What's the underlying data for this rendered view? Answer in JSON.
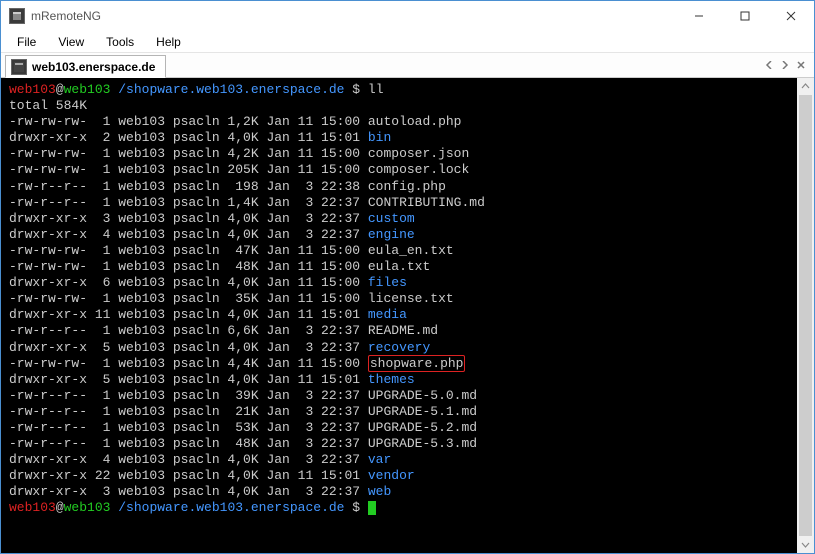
{
  "titlebar": {
    "title": "mRemoteNG"
  },
  "menu": {
    "file": "File",
    "view": "View",
    "tools": "Tools",
    "help": "Help"
  },
  "tab": {
    "label": "web103.enerspace.de"
  },
  "prompt": {
    "user": "web103",
    "at": "@",
    "host": "web103",
    "path": " /shopware.web103.enerspace.de",
    "sep": " $ ",
    "cmd": "ll"
  },
  "total": "total 584K",
  "files": [
    {
      "perm": "-rw-rw-rw-",
      "links": " 1",
      "own": "web103",
      "grp": "psacln",
      "size": "1,2K",
      "date": "Jan 11 15:00",
      "name": "autoload.php",
      "color": "white"
    },
    {
      "perm": "drwxr-xr-x",
      "links": " 2",
      "own": "web103",
      "grp": "psacln",
      "size": "4,0K",
      "date": "Jan 11 15:01",
      "name": "bin",
      "color": "blue"
    },
    {
      "perm": "-rw-rw-rw-",
      "links": " 1",
      "own": "web103",
      "grp": "psacln",
      "size": "4,2K",
      "date": "Jan 11 15:00",
      "name": "composer.json",
      "color": "white"
    },
    {
      "perm": "-rw-rw-rw-",
      "links": " 1",
      "own": "web103",
      "grp": "psacln",
      "size": "205K",
      "date": "Jan 11 15:00",
      "name": "composer.lock",
      "color": "white"
    },
    {
      "perm": "-rw-r--r--",
      "links": " 1",
      "own": "web103",
      "grp": "psacln",
      "size": " 198",
      "date": "Jan  3 22:38",
      "name": "config.php",
      "color": "white"
    },
    {
      "perm": "-rw-r--r--",
      "links": " 1",
      "own": "web103",
      "grp": "psacln",
      "size": "1,4K",
      "date": "Jan  3 22:37",
      "name": "CONTRIBUTING.md",
      "color": "white"
    },
    {
      "perm": "drwxr-xr-x",
      "links": " 3",
      "own": "web103",
      "grp": "psacln",
      "size": "4,0K",
      "date": "Jan  3 22:37",
      "name": "custom",
      "color": "blue"
    },
    {
      "perm": "drwxr-xr-x",
      "links": " 4",
      "own": "web103",
      "grp": "psacln",
      "size": "4,0K",
      "date": "Jan  3 22:37",
      "name": "engine",
      "color": "blue"
    },
    {
      "perm": "-rw-rw-rw-",
      "links": " 1",
      "own": "web103",
      "grp": "psacln",
      "size": " 47K",
      "date": "Jan 11 15:00",
      "name": "eula_en.txt",
      "color": "white"
    },
    {
      "perm": "-rw-rw-rw-",
      "links": " 1",
      "own": "web103",
      "grp": "psacln",
      "size": " 48K",
      "date": "Jan 11 15:00",
      "name": "eula.txt",
      "color": "white"
    },
    {
      "perm": "drwxr-xr-x",
      "links": " 6",
      "own": "web103",
      "grp": "psacln",
      "size": "4,0K",
      "date": "Jan 11 15:00",
      "name": "files",
      "color": "blue"
    },
    {
      "perm": "-rw-rw-rw-",
      "links": " 1",
      "own": "web103",
      "grp": "psacln",
      "size": " 35K",
      "date": "Jan 11 15:00",
      "name": "license.txt",
      "color": "white"
    },
    {
      "perm": "drwxr-xr-x",
      "links": "11",
      "own": "web103",
      "grp": "psacln",
      "size": "4,0K",
      "date": "Jan 11 15:01",
      "name": "media",
      "color": "blue"
    },
    {
      "perm": "-rw-r--r--",
      "links": " 1",
      "own": "web103",
      "grp": "psacln",
      "size": "6,6K",
      "date": "Jan  3 22:37",
      "name": "README.md",
      "color": "white"
    },
    {
      "perm": "drwxr-xr-x",
      "links": " 5",
      "own": "web103",
      "grp": "psacln",
      "size": "4,0K",
      "date": "Jan  3 22:37",
      "name": "recovery",
      "color": "blue"
    },
    {
      "perm": "-rw-rw-rw-",
      "links": " 1",
      "own": "web103",
      "grp": "psacln",
      "size": "4,4K",
      "date": "Jan 11 15:00",
      "name": "shopware.php",
      "color": "white",
      "hl": true
    },
    {
      "perm": "drwxr-xr-x",
      "links": " 5",
      "own": "web103",
      "grp": "psacln",
      "size": "4,0K",
      "date": "Jan 11 15:01",
      "name": "themes",
      "color": "blue"
    },
    {
      "perm": "-rw-r--r--",
      "links": " 1",
      "own": "web103",
      "grp": "psacln",
      "size": " 39K",
      "date": "Jan  3 22:37",
      "name": "UPGRADE-5.0.md",
      "color": "white"
    },
    {
      "perm": "-rw-r--r--",
      "links": " 1",
      "own": "web103",
      "grp": "psacln",
      "size": " 21K",
      "date": "Jan  3 22:37",
      "name": "UPGRADE-5.1.md",
      "color": "white"
    },
    {
      "perm": "-rw-r--r--",
      "links": " 1",
      "own": "web103",
      "grp": "psacln",
      "size": " 53K",
      "date": "Jan  3 22:37",
      "name": "UPGRADE-5.2.md",
      "color": "white"
    },
    {
      "perm": "-rw-r--r--",
      "links": " 1",
      "own": "web103",
      "grp": "psacln",
      "size": " 48K",
      "date": "Jan  3 22:37",
      "name": "UPGRADE-5.3.md",
      "color": "white"
    },
    {
      "perm": "drwxr-xr-x",
      "links": " 4",
      "own": "web103",
      "grp": "psacln",
      "size": "4,0K",
      "date": "Jan  3 22:37",
      "name": "var",
      "color": "blue"
    },
    {
      "perm": "drwxr-xr-x",
      "links": "22",
      "own": "web103",
      "grp": "psacln",
      "size": "4,0K",
      "date": "Jan 11 15:01",
      "name": "vendor",
      "color": "blue"
    },
    {
      "perm": "drwxr-xr-x",
      "links": " 3",
      "own": "web103",
      "grp": "psacln",
      "size": "4,0K",
      "date": "Jan  3 22:37",
      "name": "web",
      "color": "blue"
    }
  ]
}
